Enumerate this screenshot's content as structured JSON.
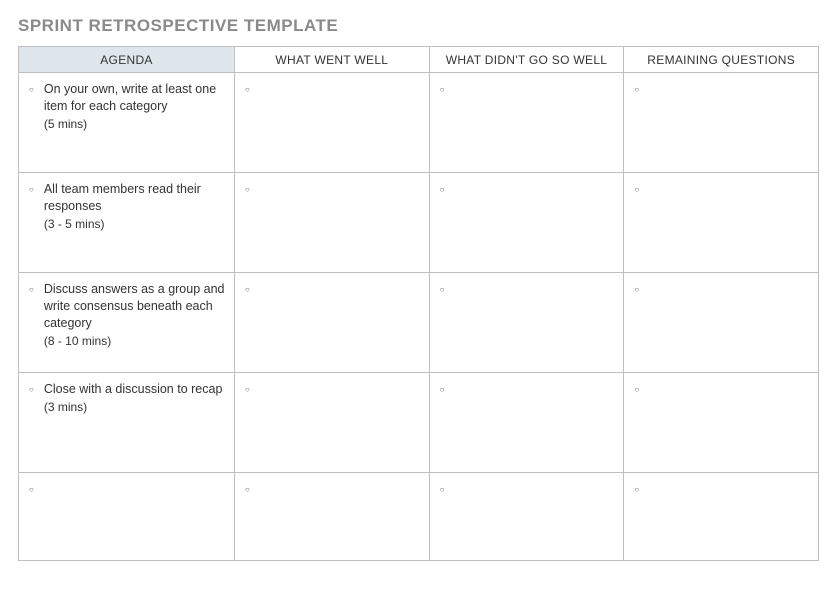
{
  "title": "SPRINT RETROSPECTIVE TEMPLATE",
  "columns": {
    "c0": "AGENDA",
    "c1": "WHAT WENT WELL",
    "c2": "WHAT DIDN'T GO SO WELL",
    "c3": "REMAINING QUESTIONS"
  },
  "rows": [
    {
      "agenda_text": "On your own, write at least one item for each category",
      "agenda_time": "(5 mins)",
      "well": "",
      "notwell": "",
      "questions": ""
    },
    {
      "agenda_text": "All team members read their responses",
      "agenda_time": "(3 - 5 mins)",
      "well": "",
      "notwell": "",
      "questions": ""
    },
    {
      "agenda_text": "Discuss answers as a group and write consensus beneath each category",
      "agenda_time": "(8 - 10 mins)",
      "well": "",
      "notwell": "",
      "questions": ""
    },
    {
      "agenda_text": "Close with a discussion to recap",
      "agenda_time": "(3 mins)",
      "well": "",
      "notwell": "",
      "questions": ""
    },
    {
      "agenda_text": "",
      "agenda_time": "",
      "well": "",
      "notwell": "",
      "questions": ""
    }
  ]
}
